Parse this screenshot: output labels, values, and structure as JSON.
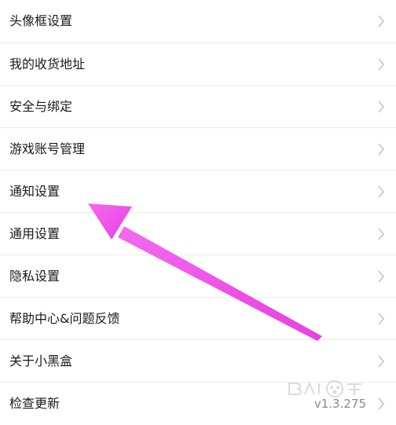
{
  "settings": {
    "items": [
      {
        "label": "头像框设置"
      },
      {
        "label": "我的收货地址"
      },
      {
        "label": "安全与绑定"
      },
      {
        "label": "游戏账号管理"
      },
      {
        "label": "通知设置"
      },
      {
        "label": "通用设置"
      },
      {
        "label": "隐私设置"
      },
      {
        "label": "帮助中心&问题反馈"
      },
      {
        "label": "关于小黑盒"
      },
      {
        "label": "检查更新",
        "value": "v1.3.275"
      }
    ]
  },
  "overlay": {
    "arrow_color": "#f04fe6",
    "arrow_target": "通知设置"
  },
  "icons": {
    "chevron": "chevron-right-icon"
  }
}
